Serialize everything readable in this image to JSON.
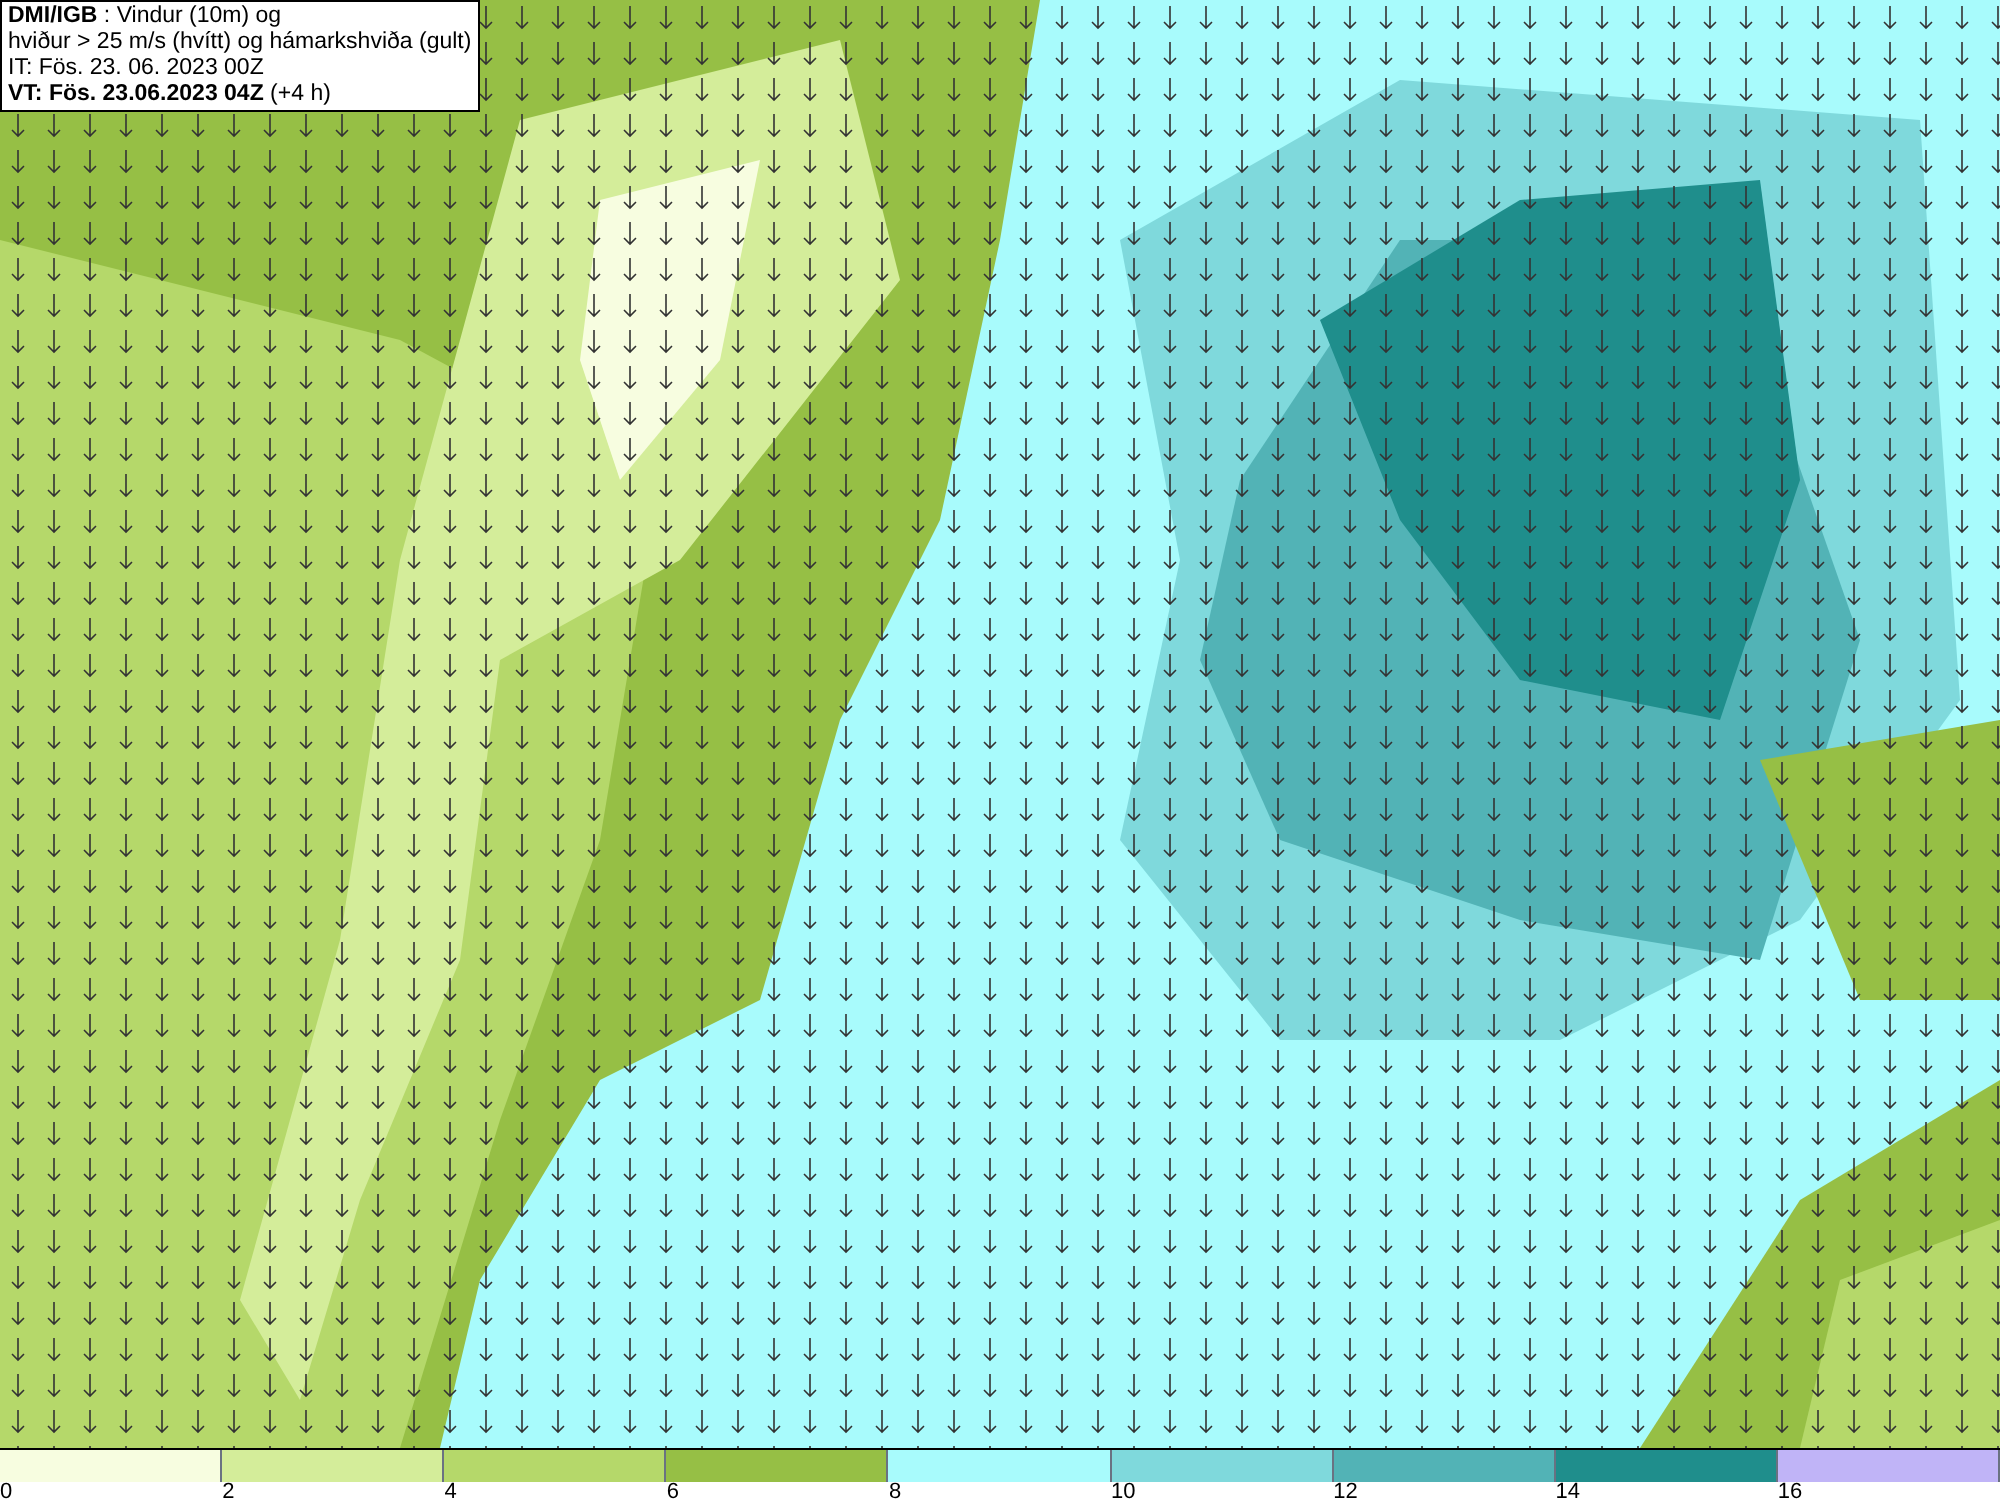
{
  "title_box": {
    "lines": [
      "**DMI/IGB** : Vindur (10m) og",
      "hviður > 25 m/s (hvítt) og hámarkshviða (gult)",
      "IT: Fös. 23. 06. 2023 00Z",
      "**VT: Fös. 23.06.2023 04Z** (+4 h)"
    ]
  },
  "legend": [
    {
      "label": "0",
      "color": "#f7fde0"
    },
    {
      "label": "2",
      "color": "#d4ed9a"
    },
    {
      "label": "4",
      "color": "#b5d86a"
    },
    {
      "label": "6",
      "color": "#96bf45"
    },
    {
      "label": "8",
      "color": "#a8fbfc"
    },
    {
      "label": "10",
      "color": "#7fd9dc"
    },
    {
      "label": "12",
      "color": "#52b3b6"
    },
    {
      "label": "14",
      "color": "#1f8e8c"
    },
    {
      "label": "16",
      "color": "#c0b4f7"
    }
  ]
}
